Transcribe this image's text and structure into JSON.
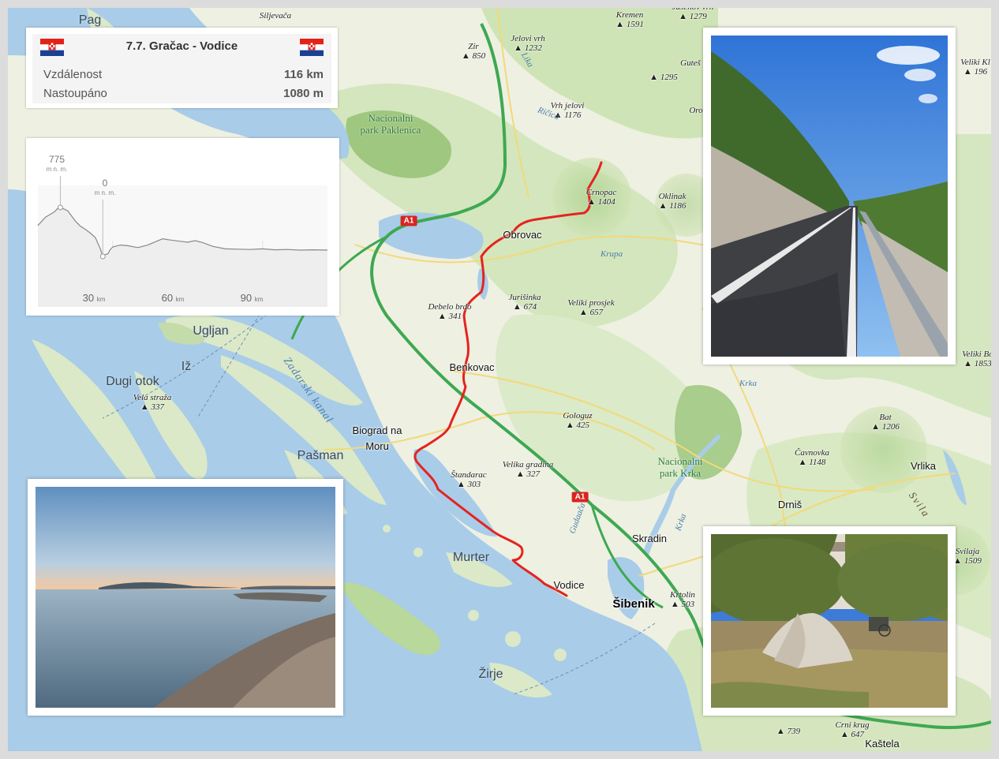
{
  "info": {
    "title": "7.7. Gračac - Vodice",
    "flag_left": "croatia-flag",
    "flag_right": "croatia-flag",
    "distance_label": "Vzdálenost",
    "distance_value": "116 km",
    "climb_label": "Nastoupáno",
    "climb_value": "1080 m"
  },
  "elevation": {
    "max_value": "775",
    "max_unit": "m n. m.",
    "min_value": "0",
    "min_unit": "m n. m.",
    "ticks": [
      {
        "value": "30",
        "unit": "km"
      },
      {
        "value": "60",
        "unit": "km"
      },
      {
        "value": "90",
        "unit": "km"
      }
    ],
    "profile_km_elev": [
      [
        0,
        490
      ],
      [
        3,
        620
      ],
      [
        6,
        690
      ],
      [
        7,
        720
      ],
      [
        8,
        765
      ],
      [
        9,
        775
      ],
      [
        10,
        760
      ],
      [
        12,
        720
      ],
      [
        15,
        560
      ],
      [
        17,
        480
      ],
      [
        19,
        430
      ],
      [
        21,
        370
      ],
      [
        23,
        300
      ],
      [
        25,
        120
      ],
      [
        26,
        0
      ],
      [
        27,
        30
      ],
      [
        28,
        40
      ],
      [
        29,
        110
      ],
      [
        30,
        150
      ],
      [
        33,
        180
      ],
      [
        36,
        170
      ],
      [
        40,
        140
      ],
      [
        44,
        180
      ],
      [
        47,
        230
      ],
      [
        50,
        280
      ],
      [
        53,
        260
      ],
      [
        57,
        240
      ],
      [
        60,
        225
      ],
      [
        63,
        250
      ],
      [
        66,
        220
      ],
      [
        70,
        160
      ],
      [
        75,
        120
      ],
      [
        80,
        115
      ],
      [
        85,
        110
      ],
      [
        90,
        120
      ],
      [
        95,
        105
      ],
      [
        100,
        110
      ],
      [
        105,
        100
      ],
      [
        110,
        105
      ],
      [
        116,
        100
      ]
    ]
  },
  "map": {
    "shield_label": "A1",
    "places": [
      {
        "name": "Obrovac",
        "kind": "town"
      },
      {
        "name": "Benkovac",
        "kind": "town"
      },
      {
        "name": "Biograd na",
        "kind": "town"
      },
      {
        "name": "Moru",
        "kind": "town"
      },
      {
        "name": "Vodice",
        "kind": "town"
      },
      {
        "name": "Šibenik",
        "kind": "city"
      },
      {
        "name": "Skradin",
        "kind": "town"
      },
      {
        "name": "Drniš",
        "kind": "town"
      },
      {
        "name": "Vrlika",
        "kind": "town"
      },
      {
        "name": "Murter",
        "kind": "island"
      },
      {
        "name": "Ugljan",
        "kind": "island"
      },
      {
        "name": "Dugi otok",
        "kind": "island"
      },
      {
        "name": "Pašman",
        "kind": "island"
      },
      {
        "name": "Iž",
        "kind": "island"
      },
      {
        "name": "Žirje",
        "kind": "island"
      },
      {
        "name": "Pag",
        "kind": "island"
      },
      {
        "name": "Kaštela",
        "kind": "town"
      }
    ],
    "peaks": [
      {
        "name": "Siljevača",
        "elev": ""
      },
      {
        "name": "Zir",
        "elev": "850"
      },
      {
        "name": "Jelovi vrh",
        "elev": "1232"
      },
      {
        "name": "Kremen",
        "elev": "1591"
      },
      {
        "name": "Jasenov vrh",
        "elev": "1279"
      },
      {
        "name": "Vrh jelovi",
        "elev": "1176"
      },
      {
        "name": "Crnopac",
        "elev": "1404"
      },
      {
        "name": "Oklinak",
        "elev": "1186"
      },
      {
        "name": "Jurišinka",
        "elev": "674"
      },
      {
        "name": "Veliki prosjek",
        "elev": "657"
      },
      {
        "name": "Debelo brdo",
        "elev": "341"
      },
      {
        "name": "Gologuz",
        "elev": "425"
      },
      {
        "name": "Velika gradina",
        "elev": "327"
      },
      {
        "name": "Štandarac",
        "elev": "303"
      },
      {
        "name": "Vela straža",
        "elev": "337"
      },
      {
        "name": "Bat",
        "elev": "1206"
      },
      {
        "name": "Čavnovka",
        "elev": "1148"
      },
      {
        "name": "Svilaja",
        "elev": "1509"
      },
      {
        "name": "Veliki Bo",
        "elev": "1853"
      },
      {
        "name": "Krtolin",
        "elev": "503"
      },
      {
        "name": "Crni krug",
        "elev": "647"
      },
      {
        "name": "",
        "elev": "1295"
      },
      {
        "name": "",
        "elev": "739"
      },
      {
        "name": "Guteš",
        "elev": ""
      },
      {
        "name": "Oro",
        "elev": ""
      },
      {
        "name": "Veliki Kl",
        "elev": "196"
      }
    ],
    "parks": [
      "Nacionalni",
      "park Paklenica",
      "Nacionalni",
      "park Krka"
    ],
    "waters": [
      "Zadarski kanal",
      "Krupa",
      "Krka",
      "Gudaača",
      "Ričica",
      "Lika",
      "Krka"
    ],
    "ridges": [
      "Svila"
    ],
    "colors": {
      "route": "#e4241f",
      "motorway": "#3ea852",
      "sea": "#a9cce8",
      "land": "#eef0e2",
      "forest": "#b8d89c"
    }
  },
  "photos": [
    "road-photo",
    "sea-shore-photo",
    "tent-camp-photo"
  ]
}
